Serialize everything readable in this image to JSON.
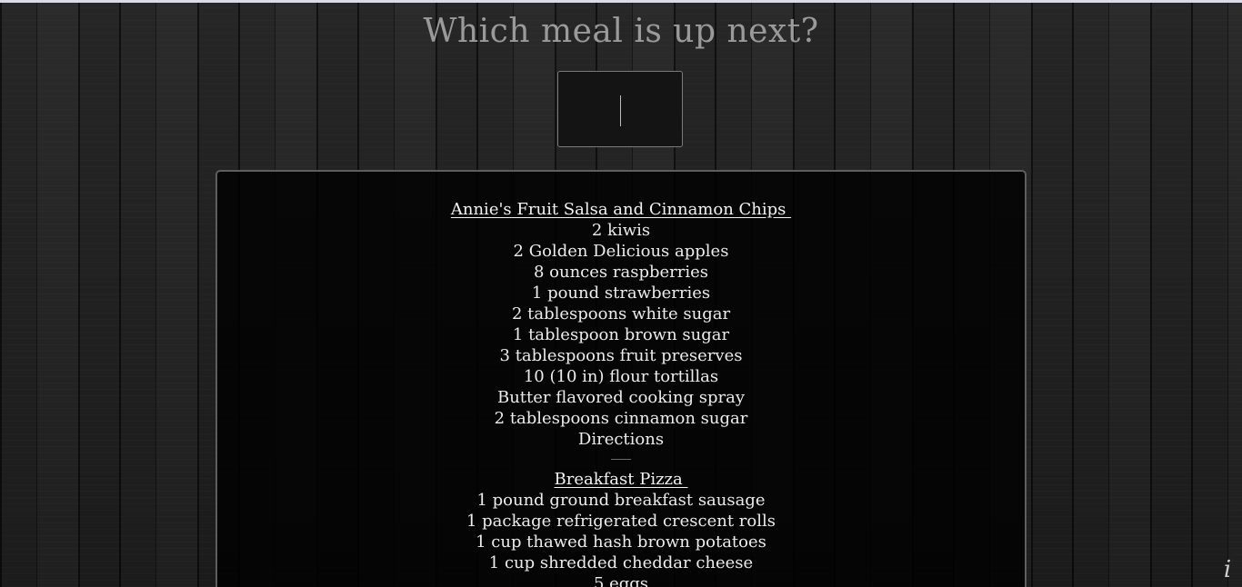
{
  "header": {
    "title": "Which meal is up next?"
  },
  "search": {
    "value": ""
  },
  "recipes": [
    {
      "title": "Annie's Fruit Salsa and Cinnamon Chips ",
      "ingredients": [
        "2 kiwis",
        "2 Golden Delicious apples",
        "8 ounces raspberries",
        "1 pound strawberries",
        "2 tablespoons white sugar",
        "1 tablespoon brown sugar",
        "3 tablespoons fruit preserves",
        "10 (10 in) flour tortillas",
        "Butter flavored cooking spray",
        "2 tablespoons cinnamon sugar"
      ],
      "directions_label": "Directions"
    },
    {
      "title": "Breakfast Pizza ",
      "ingredients": [
        "1 pound ground breakfast sausage",
        "1 package refrigerated crescent rolls",
        "1 cup thawed hash brown potatoes",
        "1 cup shredded cheddar cheese",
        "5 eggs"
      ]
    }
  ],
  "footer": {
    "info_icon_glyph": "i"
  }
}
